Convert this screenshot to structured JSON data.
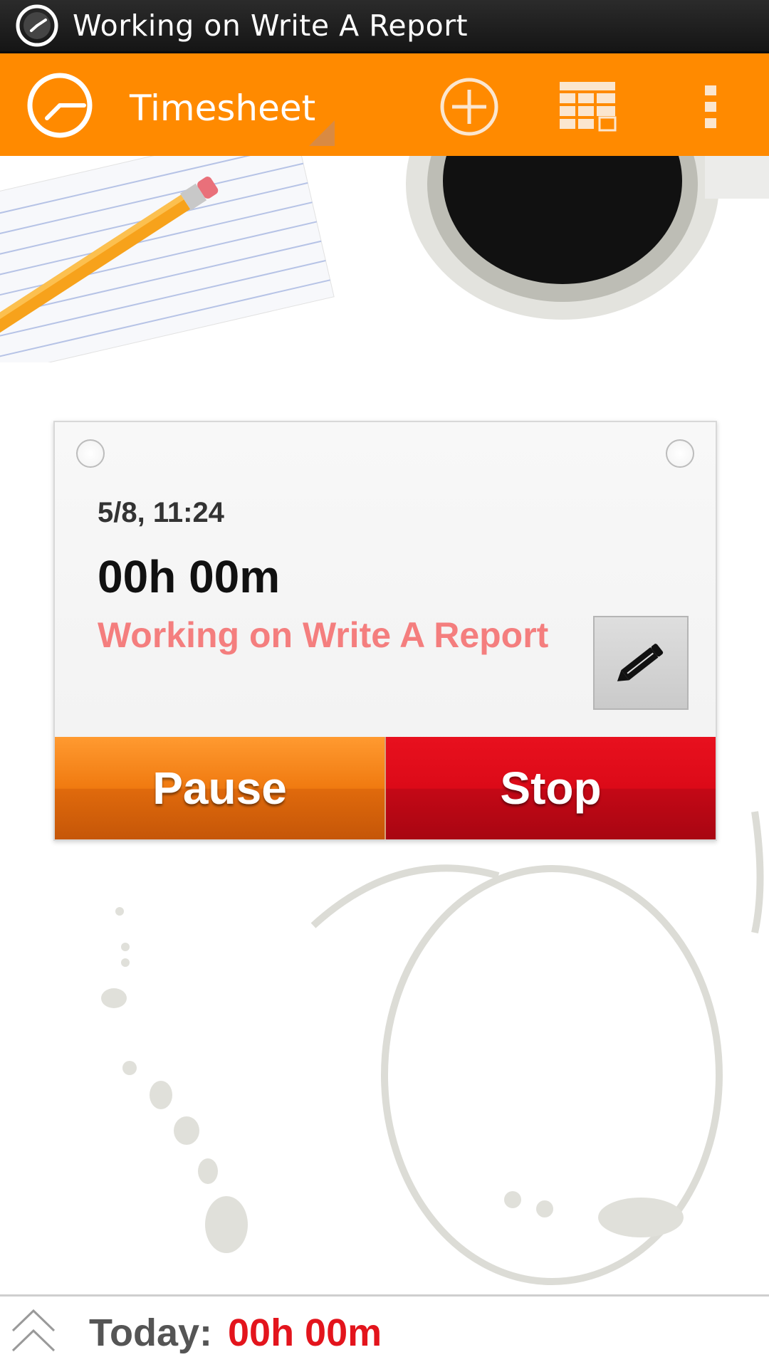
{
  "status_bar": {
    "title": "Working on Write A Report",
    "icon": "clock-notification-icon"
  },
  "action_bar": {
    "logo_icon": "clock-icon",
    "spinner_label": "Timesheet",
    "add_icon": "add-circle-icon",
    "calendar_icon": "calendar-icon",
    "overflow_icon": "overflow-menu-icon",
    "accent_color": "#ff8a00"
  },
  "timer_card": {
    "date": "5/8, 11:24",
    "duration": "00h 00m",
    "task": "Working on Write A Report",
    "edit_icon": "pencil-icon",
    "pause_label": "Pause",
    "stop_label": "Stop",
    "pause_color": "#f07a10",
    "stop_color": "#dc0a18"
  },
  "bottom_bar": {
    "expand_icon": "chevron-up-icon",
    "today_label": "Today:",
    "today_value": "00h 00m",
    "value_color": "#e3141c"
  }
}
